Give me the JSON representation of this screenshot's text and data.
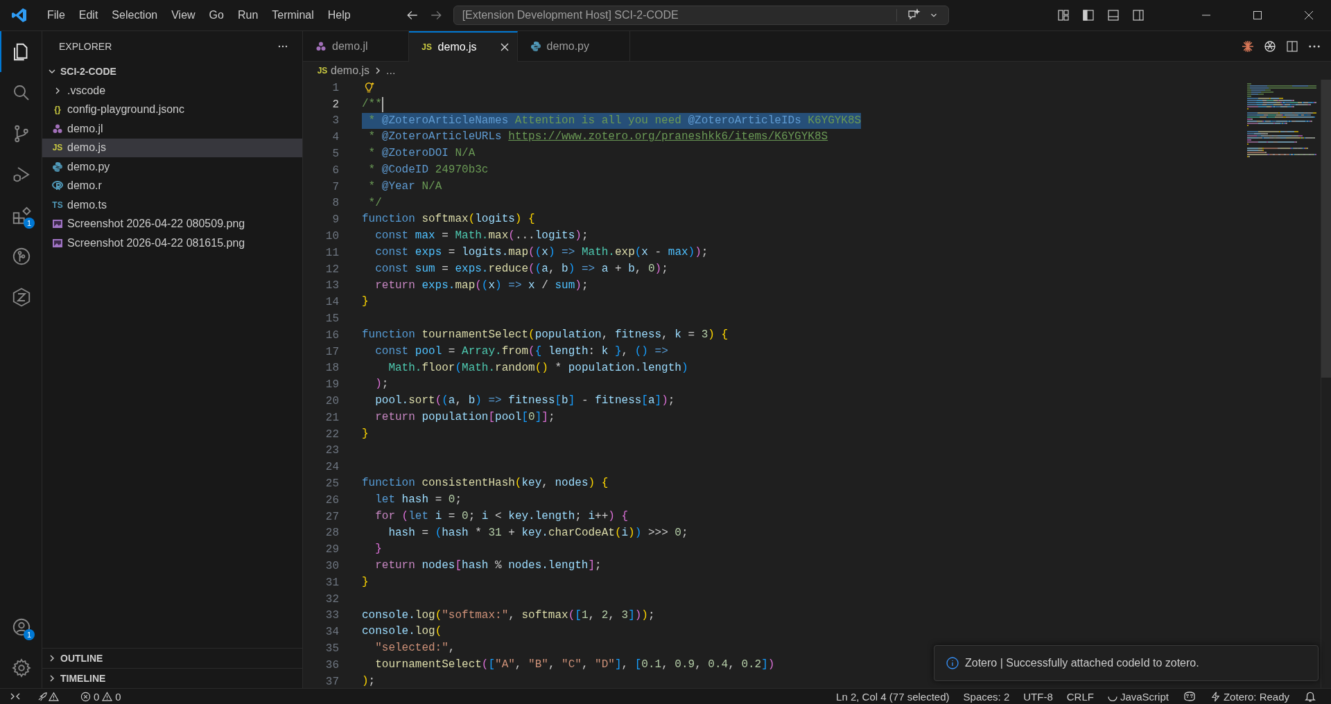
{
  "title_bar": {
    "menu": [
      "File",
      "Edit",
      "Selection",
      "View",
      "Go",
      "Run",
      "Terminal",
      "Help"
    ],
    "command_center": "[Extension Development Host] SCI-2-CODE"
  },
  "activity_bar": {
    "items": [
      {
        "kind": "explorer",
        "selected": true
      },
      {
        "kind": "search",
        "selected": false
      },
      {
        "kind": "source-control",
        "selected": false
      },
      {
        "kind": "run-debug",
        "selected": false
      },
      {
        "kind": "extensions",
        "selected": false,
        "badge": "1"
      },
      {
        "kind": "git-graph",
        "selected": false
      },
      {
        "kind": "zotero",
        "selected": false
      }
    ],
    "bottom": [
      {
        "kind": "accounts",
        "badge": "1"
      },
      {
        "kind": "settings"
      }
    ]
  },
  "sidebar": {
    "title": "EXPLORER",
    "root": {
      "label": "SCI-2-CODE",
      "expanded": true,
      "children": [
        {
          "label": ".vscode",
          "kind": "folder",
          "expanded": false,
          "selected": false
        },
        {
          "label": "config-playground.jsonc",
          "kind": "json",
          "icon_text": "{}",
          "selected": false
        },
        {
          "label": "demo.jl",
          "kind": "julia",
          "selected": false
        },
        {
          "label": "demo.js",
          "kind": "js",
          "icon_text": "JS",
          "selected": true
        },
        {
          "label": "demo.py",
          "kind": "python",
          "selected": false
        },
        {
          "label": "demo.r",
          "kind": "r",
          "selected": false
        },
        {
          "label": "demo.ts",
          "kind": "ts",
          "icon_text": "TS",
          "selected": false
        },
        {
          "label": "Screenshot 2026-04-22 080509.png",
          "kind": "image",
          "selected": false
        },
        {
          "label": "Screenshot 2026-04-22 081615.png",
          "kind": "image",
          "selected": false
        }
      ]
    },
    "sections": [
      {
        "label": "OUTLINE",
        "expanded": false
      },
      {
        "label": "TIMELINE",
        "expanded": false
      }
    ]
  },
  "tabs": [
    {
      "label": "demo.jl",
      "kind": "julia",
      "selected": false
    },
    {
      "label": "demo.js",
      "kind": "js",
      "icon_text": "JS",
      "selected": true
    },
    {
      "label": "demo.py",
      "kind": "python",
      "selected": false
    }
  ],
  "breadcrumb": {
    "icon_text": "JS",
    "file": "demo.js",
    "rest": "..."
  },
  "editor": {
    "lines": [
      {
        "number": "1",
        "cursor": false,
        "selected": false
      },
      {
        "number": "2",
        "cursor": true,
        "selected": false,
        "tokens": [
          {
            "kind": "c",
            "text": "/**"
          }
        ]
      },
      {
        "number": "3",
        "cursor": false,
        "selected": true,
        "tokens": [
          {
            "kind": "c",
            "text": " * "
          },
          {
            "kind": "ct",
            "text": "@ZoteroArticleNames"
          },
          {
            "kind": "c",
            "text": " Attention is all you need "
          },
          {
            "kind": "ct",
            "text": "@ZoteroArticleIDs"
          },
          {
            "kind": "c",
            "text": " K6YGYK8S"
          }
        ]
      },
      {
        "number": "4",
        "cursor": false,
        "selected": false,
        "tokens": [
          {
            "kind": "c",
            "text": " * "
          },
          {
            "kind": "ct",
            "text": "@ZoteroArticleURLs "
          },
          {
            "kind": "u",
            "text": "https://www.zotero.org/praneshkk6/items/K6YGYK8S"
          }
        ]
      },
      {
        "number": "5",
        "cursor": false,
        "selected": false,
        "tokens": [
          {
            "kind": "c",
            "text": " * "
          },
          {
            "kind": "ct",
            "text": "@ZoteroDOI"
          },
          {
            "kind": "c",
            "text": " N/A"
          }
        ]
      },
      {
        "number": "6",
        "cursor": false,
        "selected": false,
        "tokens": [
          {
            "kind": "c",
            "text": " * "
          },
          {
            "kind": "ct",
            "text": "@CodeID"
          },
          {
            "kind": "c",
            "text": " 24970b3c"
          }
        ]
      },
      {
        "number": "7",
        "cursor": false,
        "selected": false,
        "tokens": [
          {
            "kind": "c",
            "text": " * "
          },
          {
            "kind": "ct",
            "text": "@Year"
          },
          {
            "kind": "c",
            "text": " N/A"
          }
        ]
      },
      {
        "number": "8",
        "cursor": false,
        "selected": false,
        "tokens": [
          {
            "kind": "c",
            "text": " */"
          }
        ]
      },
      {
        "number": "9",
        "cursor": false,
        "selected": false,
        "tokens": [
          {
            "kind": "k",
            "text": "function"
          },
          {
            "kind": "f",
            "text": " softmax"
          },
          {
            "kind": "b1",
            "text": "("
          },
          {
            "kind": "v",
            "text": "logits"
          },
          {
            "kind": "b1",
            "text": ")"
          },
          {
            "kind": "b1",
            "text": " {"
          }
        ]
      },
      {
        "number": "10",
        "cursor": false,
        "selected": false,
        "tokens": [
          {
            "kind": "k",
            "text": "  const"
          },
          {
            "kind": "cv",
            "text": " max"
          },
          {
            "kind": "p",
            "text": " = "
          },
          {
            "kind": "cls",
            "text": "Math."
          },
          {
            "kind": "f",
            "text": "max"
          },
          {
            "kind": "b2",
            "text": "("
          },
          {
            "kind": "p",
            "text": "..."
          },
          {
            "kind": "v",
            "text": "logits"
          },
          {
            "kind": "b2",
            "text": ")"
          },
          {
            "kind": "p",
            "text": ";"
          }
        ]
      },
      {
        "number": "11",
        "cursor": false,
        "selected": false,
        "tokens": [
          {
            "kind": "k",
            "text": "  const"
          },
          {
            "kind": "cv",
            "text": " exps"
          },
          {
            "kind": "p",
            "text": " = "
          },
          {
            "kind": "v",
            "text": "logits."
          },
          {
            "kind": "f",
            "text": "map"
          },
          {
            "kind": "b2",
            "text": "("
          },
          {
            "kind": "b3",
            "text": "("
          },
          {
            "kind": "v",
            "text": "x"
          },
          {
            "kind": "b3",
            "text": ")"
          },
          {
            "kind": "k",
            "text": " =>"
          },
          {
            "kind": "cls",
            "text": " Math."
          },
          {
            "kind": "f",
            "text": "exp"
          },
          {
            "kind": "b3",
            "text": "("
          },
          {
            "kind": "v",
            "text": "x"
          },
          {
            "kind": "p",
            "text": " - "
          },
          {
            "kind": "cv",
            "text": "max"
          },
          {
            "kind": "b3",
            "text": ")"
          },
          {
            "kind": "b2",
            "text": ")"
          },
          {
            "kind": "p",
            "text": ";"
          }
        ]
      },
      {
        "number": "12",
        "cursor": false,
        "selected": false,
        "tokens": [
          {
            "kind": "k",
            "text": "  const"
          },
          {
            "kind": "cv",
            "text": " sum"
          },
          {
            "kind": "p",
            "text": " = "
          },
          {
            "kind": "cv",
            "text": "exps."
          },
          {
            "kind": "f",
            "text": "reduce"
          },
          {
            "kind": "b2",
            "text": "("
          },
          {
            "kind": "b3",
            "text": "("
          },
          {
            "kind": "v",
            "text": "a"
          },
          {
            "kind": "p",
            "text": ", "
          },
          {
            "kind": "v",
            "text": "b"
          },
          {
            "kind": "b3",
            "text": ")"
          },
          {
            "kind": "k",
            "text": " =>"
          },
          {
            "kind": "v",
            "text": " a"
          },
          {
            "kind": "p",
            "text": " + "
          },
          {
            "kind": "v",
            "text": "b"
          },
          {
            "kind": "p",
            "text": ", "
          },
          {
            "kind": "n",
            "text": "0"
          },
          {
            "kind": "b2",
            "text": ")"
          },
          {
            "kind": "p",
            "text": ";"
          }
        ]
      },
      {
        "number": "13",
        "cursor": false,
        "selected": false,
        "tokens": [
          {
            "kind": "kc",
            "text": "  return"
          },
          {
            "kind": "cv",
            "text": " exps."
          },
          {
            "kind": "f",
            "text": "map"
          },
          {
            "kind": "b2",
            "text": "("
          },
          {
            "kind": "b3",
            "text": "("
          },
          {
            "kind": "v",
            "text": "x"
          },
          {
            "kind": "b3",
            "text": ")"
          },
          {
            "kind": "k",
            "text": " =>"
          },
          {
            "kind": "v",
            "text": " x"
          },
          {
            "kind": "p",
            "text": " / "
          },
          {
            "kind": "cv",
            "text": "sum"
          },
          {
            "kind": "b2",
            "text": ")"
          },
          {
            "kind": "p",
            "text": ";"
          }
        ]
      },
      {
        "number": "14",
        "cursor": false,
        "selected": false,
        "tokens": [
          {
            "kind": "b1",
            "text": "}"
          }
        ]
      },
      {
        "number": "15",
        "cursor": false,
        "selected": false
      },
      {
        "number": "16",
        "cursor": false,
        "selected": false,
        "tokens": [
          {
            "kind": "k",
            "text": "function"
          },
          {
            "kind": "f",
            "text": " tournamentSelect"
          },
          {
            "kind": "b1",
            "text": "("
          },
          {
            "kind": "v",
            "text": "population"
          },
          {
            "kind": "p",
            "text": ", "
          },
          {
            "kind": "v",
            "text": "fitness"
          },
          {
            "kind": "p",
            "text": ", "
          },
          {
            "kind": "v",
            "text": "k"
          },
          {
            "kind": "p",
            "text": " = "
          },
          {
            "kind": "n",
            "text": "3"
          },
          {
            "kind": "b1",
            "text": ")"
          },
          {
            "kind": "b1",
            "text": " {"
          }
        ]
      },
      {
        "number": "17",
        "cursor": false,
        "selected": false,
        "tokens": [
          {
            "kind": "k",
            "text": "  const"
          },
          {
            "kind": "cv",
            "text": " pool"
          },
          {
            "kind": "p",
            "text": " = "
          },
          {
            "kind": "cls",
            "text": "Array."
          },
          {
            "kind": "f",
            "text": "from"
          },
          {
            "kind": "b2",
            "text": "("
          },
          {
            "kind": "b3",
            "text": "{"
          },
          {
            "kind": "v",
            "text": " length"
          },
          {
            "kind": "p",
            "text": ": "
          },
          {
            "kind": "v",
            "text": "k"
          },
          {
            "kind": "b3",
            "text": " }"
          },
          {
            "kind": "p",
            "text": ", "
          },
          {
            "kind": "b3",
            "text": "()"
          },
          {
            "kind": "k",
            "text": " =>"
          }
        ]
      },
      {
        "number": "18",
        "cursor": false,
        "selected": false,
        "tokens": [
          {
            "kind": "cls",
            "text": "    Math."
          },
          {
            "kind": "f",
            "text": "floor"
          },
          {
            "kind": "b3",
            "text": "("
          },
          {
            "kind": "cls",
            "text": "Math."
          },
          {
            "kind": "f",
            "text": "random"
          },
          {
            "kind": "b1",
            "text": "()"
          },
          {
            "kind": "p",
            "text": " * "
          },
          {
            "kind": "v",
            "text": "population.length"
          },
          {
            "kind": "b3",
            "text": ")"
          }
        ]
      },
      {
        "number": "19",
        "cursor": false,
        "selected": false,
        "tokens": [
          {
            "kind": "b2",
            "text": "  )"
          },
          {
            "kind": "p",
            "text": ";"
          }
        ]
      },
      {
        "number": "20",
        "cursor": false,
        "selected": false,
        "tokens": [
          {
            "kind": "v",
            "text": "  pool."
          },
          {
            "kind": "f",
            "text": "sort"
          },
          {
            "kind": "b2",
            "text": "("
          },
          {
            "kind": "b3",
            "text": "("
          },
          {
            "kind": "v",
            "text": "a"
          },
          {
            "kind": "p",
            "text": ", "
          },
          {
            "kind": "v",
            "text": "b"
          },
          {
            "kind": "b3",
            "text": ")"
          },
          {
            "kind": "k",
            "text": " =>"
          },
          {
            "kind": "v",
            "text": " fitness"
          },
          {
            "kind": "b3",
            "text": "["
          },
          {
            "kind": "v",
            "text": "b"
          },
          {
            "kind": "b3",
            "text": "]"
          },
          {
            "kind": "p",
            "text": " - "
          },
          {
            "kind": "v",
            "text": "fitness"
          },
          {
            "kind": "b3",
            "text": "["
          },
          {
            "kind": "v",
            "text": "a"
          },
          {
            "kind": "b3",
            "text": "]"
          },
          {
            "kind": "b2",
            "text": ")"
          },
          {
            "kind": "p",
            "text": ";"
          }
        ]
      },
      {
        "number": "21",
        "cursor": false,
        "selected": false,
        "tokens": [
          {
            "kind": "kc",
            "text": "  return"
          },
          {
            "kind": "v",
            "text": " population"
          },
          {
            "kind": "b2",
            "text": "["
          },
          {
            "kind": "v",
            "text": "pool"
          },
          {
            "kind": "b3",
            "text": "["
          },
          {
            "kind": "n",
            "text": "0"
          },
          {
            "kind": "b3",
            "text": "]"
          },
          {
            "kind": "b2",
            "text": "]"
          },
          {
            "kind": "p",
            "text": ";"
          }
        ]
      },
      {
        "number": "22",
        "cursor": false,
        "selected": false,
        "tokens": [
          {
            "kind": "b1",
            "text": "}"
          }
        ]
      },
      {
        "number": "23",
        "cursor": false,
        "selected": false
      },
      {
        "number": "24",
        "cursor": false,
        "selected": false
      },
      {
        "number": "25",
        "cursor": false,
        "selected": false,
        "tokens": [
          {
            "kind": "k",
            "text": "function"
          },
          {
            "kind": "f",
            "text": " consistentHash"
          },
          {
            "kind": "b1",
            "text": "("
          },
          {
            "kind": "v",
            "text": "key"
          },
          {
            "kind": "p",
            "text": ", "
          },
          {
            "kind": "v",
            "text": "nodes"
          },
          {
            "kind": "b1",
            "text": ")"
          },
          {
            "kind": "b1",
            "text": " {"
          }
        ]
      },
      {
        "number": "26",
        "cursor": false,
        "selected": false,
        "tokens": [
          {
            "kind": "k",
            "text": "  let"
          },
          {
            "kind": "v",
            "text": " hash"
          },
          {
            "kind": "p",
            "text": " = "
          },
          {
            "kind": "n",
            "text": "0"
          },
          {
            "kind": "p",
            "text": ";"
          }
        ]
      },
      {
        "number": "27",
        "cursor": false,
        "selected": false,
        "tokens": [
          {
            "kind": "kc",
            "text": "  for"
          },
          {
            "kind": "b2",
            "text": " ("
          },
          {
            "kind": "k",
            "text": "let"
          },
          {
            "kind": "v",
            "text": " i"
          },
          {
            "kind": "p",
            "text": " = "
          },
          {
            "kind": "n",
            "text": "0"
          },
          {
            "kind": "p",
            "text": "; "
          },
          {
            "kind": "v",
            "text": "i"
          },
          {
            "kind": "p",
            "text": " < "
          },
          {
            "kind": "v",
            "text": "key.length"
          },
          {
            "kind": "p",
            "text": "; "
          },
          {
            "kind": "v",
            "text": "i"
          },
          {
            "kind": "p",
            "text": "++"
          },
          {
            "kind": "b2",
            "text": ")"
          },
          {
            "kind": "b2",
            "text": " {"
          }
        ]
      },
      {
        "number": "28",
        "cursor": false,
        "selected": false,
        "tokens": [
          {
            "kind": "v",
            "text": "    hash"
          },
          {
            "kind": "p",
            "text": " = "
          },
          {
            "kind": "b3",
            "text": "("
          },
          {
            "kind": "v",
            "text": "hash"
          },
          {
            "kind": "p",
            "text": " * "
          },
          {
            "kind": "n",
            "text": "31"
          },
          {
            "kind": "p",
            "text": " + "
          },
          {
            "kind": "v",
            "text": "key."
          },
          {
            "kind": "f",
            "text": "charCodeAt"
          },
          {
            "kind": "b1",
            "text": "("
          },
          {
            "kind": "v",
            "text": "i"
          },
          {
            "kind": "b1",
            "text": ")"
          },
          {
            "kind": "b3",
            "text": ")"
          },
          {
            "kind": "p",
            "text": " >>> "
          },
          {
            "kind": "n",
            "text": "0"
          },
          {
            "kind": "p",
            "text": ";"
          }
        ]
      },
      {
        "number": "29",
        "cursor": false,
        "selected": false,
        "tokens": [
          {
            "kind": "b2",
            "text": "  }"
          }
        ]
      },
      {
        "number": "30",
        "cursor": false,
        "selected": false,
        "tokens": [
          {
            "kind": "kc",
            "text": "  return"
          },
          {
            "kind": "v",
            "text": " nodes"
          },
          {
            "kind": "b2",
            "text": "["
          },
          {
            "kind": "v",
            "text": "hash"
          },
          {
            "kind": "p",
            "text": " % "
          },
          {
            "kind": "v",
            "text": "nodes.length"
          },
          {
            "kind": "b2",
            "text": "]"
          },
          {
            "kind": "p",
            "text": ";"
          }
        ]
      },
      {
        "number": "31",
        "cursor": false,
        "selected": false,
        "tokens": [
          {
            "kind": "b1",
            "text": "}"
          }
        ]
      },
      {
        "number": "32",
        "cursor": false,
        "selected": false
      },
      {
        "number": "33",
        "cursor": false,
        "selected": false,
        "tokens": [
          {
            "kind": "v",
            "text": "console."
          },
          {
            "kind": "f",
            "text": "log"
          },
          {
            "kind": "b1",
            "text": "("
          },
          {
            "kind": "s",
            "text": "\"softmax:\""
          },
          {
            "kind": "p",
            "text": ", "
          },
          {
            "kind": "f",
            "text": "softmax"
          },
          {
            "kind": "b2",
            "text": "("
          },
          {
            "kind": "b3",
            "text": "["
          },
          {
            "kind": "n",
            "text": "1"
          },
          {
            "kind": "p",
            "text": ", "
          },
          {
            "kind": "n",
            "text": "2"
          },
          {
            "kind": "p",
            "text": ", "
          },
          {
            "kind": "n",
            "text": "3"
          },
          {
            "kind": "b3",
            "text": "]"
          },
          {
            "kind": "b2",
            "text": ")"
          },
          {
            "kind": "b1",
            "text": ")"
          },
          {
            "kind": "p",
            "text": ";"
          }
        ]
      },
      {
        "number": "34",
        "cursor": false,
        "selected": false,
        "tokens": [
          {
            "kind": "v",
            "text": "console."
          },
          {
            "kind": "f",
            "text": "log"
          },
          {
            "kind": "b1",
            "text": "("
          }
        ]
      },
      {
        "number": "35",
        "cursor": false,
        "selected": false,
        "tokens": [
          {
            "kind": "s",
            "text": "  \"selected:\""
          },
          {
            "kind": "p",
            "text": ","
          }
        ]
      },
      {
        "number": "36",
        "cursor": false,
        "selected": false,
        "tokens": [
          {
            "kind": "f",
            "text": "  tournamentSelect"
          },
          {
            "kind": "b2",
            "text": "("
          },
          {
            "kind": "b3",
            "text": "["
          },
          {
            "kind": "s",
            "text": "\"A\""
          },
          {
            "kind": "p",
            "text": ", "
          },
          {
            "kind": "s",
            "text": "\"B\""
          },
          {
            "kind": "p",
            "text": ", "
          },
          {
            "kind": "s",
            "text": "\"C\""
          },
          {
            "kind": "p",
            "text": ", "
          },
          {
            "kind": "s",
            "text": "\"D\""
          },
          {
            "kind": "b3",
            "text": "]"
          },
          {
            "kind": "p",
            "text": ", "
          },
          {
            "kind": "b3",
            "text": "["
          },
          {
            "kind": "n",
            "text": "0.1"
          },
          {
            "kind": "p",
            "text": ", "
          },
          {
            "kind": "n",
            "text": "0.9"
          },
          {
            "kind": "p",
            "text": ", "
          },
          {
            "kind": "n",
            "text": "0.4"
          },
          {
            "kind": "p",
            "text": ", "
          },
          {
            "kind": "n",
            "text": "0.2"
          },
          {
            "kind": "b3",
            "text": "]"
          },
          {
            "kind": "b2",
            "text": ")"
          }
        ]
      },
      {
        "number": "37",
        "cursor": false,
        "selected": false,
        "tokens": [
          {
            "kind": "b1",
            "text": ")"
          },
          {
            "kind": "p",
            "text": ";"
          }
        ]
      }
    ]
  },
  "notification": {
    "message": "Zotero | Successfully attached codeId to zotero."
  },
  "status_bar": {
    "problems": {
      "errors": "0",
      "warnings": "0"
    },
    "right": [
      {
        "kind": "text",
        "label": "Ln 2, Col 4 (77 selected)"
      },
      {
        "kind": "text",
        "label": "Spaces: 2"
      },
      {
        "kind": "text",
        "label": "UTF-8"
      },
      {
        "kind": "text",
        "label": "CRLF"
      },
      {
        "kind": "language",
        "label": "JavaScript"
      },
      {
        "kind": "copilot"
      },
      {
        "kind": "zotero",
        "label": "Zotero: Ready"
      },
      {
        "kind": "bell"
      }
    ]
  }
}
